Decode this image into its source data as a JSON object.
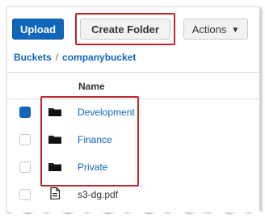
{
  "toolbar": {
    "upload_label": "Upload",
    "create_folder_label": "Create Folder",
    "actions_label": "Actions"
  },
  "breadcrumb": {
    "root_label": "Buckets",
    "separator": "/",
    "current_label": "companybucket"
  },
  "table": {
    "column_name": "Name",
    "rows": [
      {
        "name": "Development",
        "type": "folder",
        "checked": true
      },
      {
        "name": "Finance",
        "type": "folder",
        "checked": false
      },
      {
        "name": "Private",
        "type": "folder",
        "checked": false
      },
      {
        "name": "s3-dg.pdf",
        "type": "file",
        "checked": false
      }
    ]
  },
  "colors": {
    "primary": "#1166bb",
    "highlight": "#c0262d",
    "link": "#1166bb"
  },
  "icons": {
    "folder": "folder-icon",
    "file": "document-icon",
    "caret": "chevron-down-icon"
  }
}
